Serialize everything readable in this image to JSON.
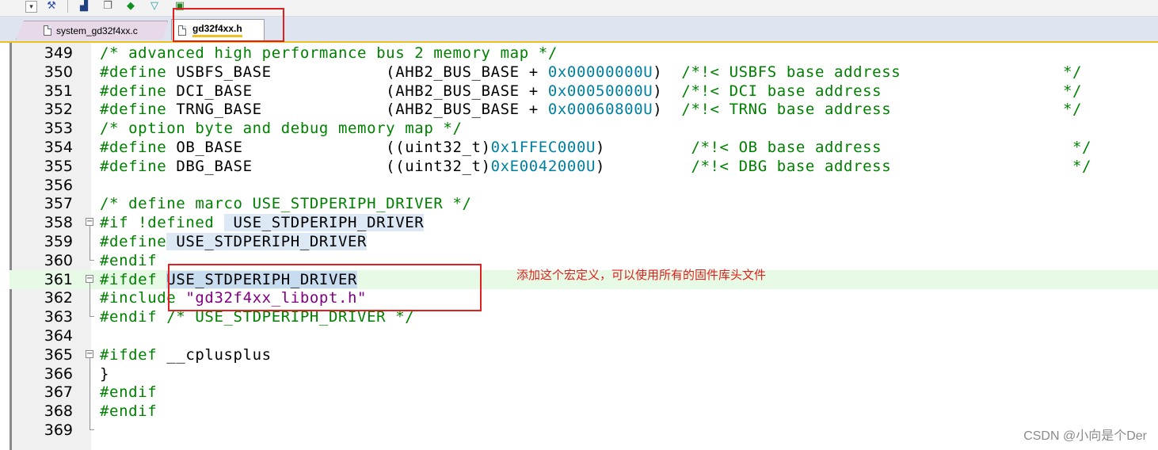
{
  "toolbar": {
    "icons": [
      "dropdown-arrow-icon",
      "wand-icon",
      "build-icon",
      "windows-icon",
      "diamond-icon",
      "filter-icon",
      "target-icon"
    ]
  },
  "tabs": [
    {
      "label": "system_gd32f4xx.c",
      "active": false
    },
    {
      "label": "gd32f4xx.h",
      "active": true
    }
  ],
  "editor": {
    "lines": [
      {
        "n": "349",
        "segments": [
          {
            "t": "/* advanced high performance bus 2 memory map */",
            "c": "cmt"
          }
        ]
      },
      {
        "n": "350",
        "segments": [
          {
            "t": "#define",
            "c": "pre"
          },
          {
            "t": " USBFS_BASE            (AHB2_BUS_BASE + ",
            "c": ""
          },
          {
            "t": "0x00000000U",
            "c": "num"
          },
          {
            "t": ")  ",
            "c": ""
          },
          {
            "t": "/*!< USBFS base address                 */",
            "c": "cmt"
          }
        ]
      },
      {
        "n": "351",
        "segments": [
          {
            "t": "#define",
            "c": "pre"
          },
          {
            "t": " DCI_BASE              (AHB2_BUS_BASE + ",
            "c": ""
          },
          {
            "t": "0x00050000U",
            "c": "num"
          },
          {
            "t": ")  ",
            "c": ""
          },
          {
            "t": "/*!< DCI base address                   */",
            "c": "cmt"
          }
        ]
      },
      {
        "n": "352",
        "segments": [
          {
            "t": "#define",
            "c": "pre"
          },
          {
            "t": " TRNG_BASE             (AHB2_BUS_BASE + ",
            "c": ""
          },
          {
            "t": "0x00060800U",
            "c": "num"
          },
          {
            "t": ")  ",
            "c": ""
          },
          {
            "t": "/*!< TRNG base address                  */",
            "c": "cmt"
          }
        ]
      },
      {
        "n": "353",
        "segments": [
          {
            "t": "/* option byte and debug memory map */",
            "c": "cmt"
          }
        ]
      },
      {
        "n": "354",
        "segments": [
          {
            "t": "#define",
            "c": "pre"
          },
          {
            "t": " OB_BASE               ((uint32_t)",
            "c": ""
          },
          {
            "t": "0x1FFEC000U",
            "c": "num"
          },
          {
            "t": ")         ",
            "c": ""
          },
          {
            "t": "/*!< OB base address                    */",
            "c": "cmt"
          }
        ]
      },
      {
        "n": "355",
        "segments": [
          {
            "t": "#define",
            "c": "pre"
          },
          {
            "t": " DBG_BASE              ((uint32_t)",
            "c": ""
          },
          {
            "t": "0xE0042000U",
            "c": "num"
          },
          {
            "t": ")         ",
            "c": ""
          },
          {
            "t": "/*!< DBG base address                   */",
            "c": "cmt"
          }
        ]
      },
      {
        "n": "356",
        "segments": []
      },
      {
        "n": "357",
        "segments": [
          {
            "t": "/* define marco USE_STDPERIPH_DRIVER */",
            "c": "cmt"
          }
        ]
      },
      {
        "n": "358",
        "segments": [
          {
            "t": "#if !defined ",
            "c": "pre"
          },
          {
            "t": " USE_STDPERIPH_DRIVER",
            "c": "hl"
          }
        ]
      },
      {
        "n": "359",
        "segments": [
          {
            "t": "#define",
            "c": "pre"
          },
          {
            "t": " USE_STDPERIPH_DRIVER",
            "c": "hl"
          }
        ]
      },
      {
        "n": "360",
        "segments": [
          {
            "t": "#endif",
            "c": "pre"
          }
        ]
      },
      {
        "n": "361",
        "segments": [
          {
            "t": "#ifdef",
            "c": "pre"
          },
          {
            "t": " ",
            "c": ""
          },
          {
            "t": "USE_STDPERIPH_DRIVER",
            "c": "hl2"
          }
        ]
      },
      {
        "n": "362",
        "segments": [
          {
            "t": "#include ",
            "c": "pre"
          },
          {
            "t": "\"gd32f4xx_libopt.h\"",
            "c": "str"
          }
        ]
      },
      {
        "n": "363",
        "segments": [
          {
            "t": "#endif",
            "c": "pre"
          },
          {
            "t": " ",
            "c": ""
          },
          {
            "t": "/* USE_STDPERIPH_DRIVER */",
            "c": "cmt"
          }
        ]
      },
      {
        "n": "364",
        "segments": []
      },
      {
        "n": "365",
        "segments": [
          {
            "t": "#ifdef",
            "c": "pre"
          },
          {
            "t": " __cplusplus",
            "c": ""
          }
        ]
      },
      {
        "n": "366",
        "segments": [
          {
            "t": "}",
            "c": ""
          }
        ]
      },
      {
        "n": "367",
        "segments": [
          {
            "t": "#endif",
            "c": "pre"
          }
        ]
      },
      {
        "n": "368",
        "segments": [
          {
            "t": "#endif",
            "c": "pre"
          }
        ]
      },
      {
        "n": "369",
        "segments": []
      }
    ]
  },
  "annotation": "添加这个宏定义，可以使用所有的固件库头文件",
  "watermark": "CSDN @小向是个Der",
  "colors": {
    "annotation": "#e02020",
    "comment": "#008000",
    "number": "#0080a0",
    "string": "#800080"
  }
}
